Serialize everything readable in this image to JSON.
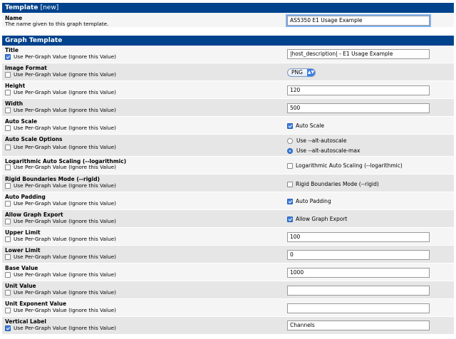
{
  "template_panel": {
    "title": "Template",
    "title_suffix": "[new]",
    "name_label": "Name",
    "name_desc": "The name given to this graph template.",
    "name_value": "AS5350 E1 Usage Example"
  },
  "graph_panel": {
    "title": "Graph Template",
    "per_graph_label": "Use Per-Graph Value (Ignore this Value)",
    "rows": {
      "title": {
        "label": "Title",
        "per_graph": true,
        "value": "|host_description| - E1 Usage Example"
      },
      "image_format": {
        "label": "Image Format",
        "per_graph": false,
        "value": "PNG"
      },
      "height": {
        "label": "Height",
        "per_graph": false,
        "value": "120"
      },
      "width": {
        "label": "Width",
        "per_graph": false,
        "value": "500"
      },
      "auto_scale": {
        "label": "Auto Scale",
        "per_graph": false,
        "option": "Auto Scale",
        "checked": true
      },
      "auto_scale_options": {
        "label": "Auto Scale Options",
        "per_graph": false,
        "opt1": "Use --alt-autoscale",
        "opt2": "Use --alt-autoscale-max",
        "selected": "opt2"
      },
      "log_scaling": {
        "label": "Logarithmic Auto Scaling (--logarithmic)",
        "per_graph": false,
        "option": "Logarithmic Auto Scaling (--logarithmic)",
        "checked": false
      },
      "rigid": {
        "label": "Rigid Boundaries Mode (--rigid)",
        "per_graph": false,
        "option": "Rigid Boundaries Mode (--rigid)",
        "checked": false
      },
      "auto_padding": {
        "label": "Auto Padding",
        "per_graph": false,
        "option": "Auto Padding",
        "checked": true
      },
      "graph_export": {
        "label": "Allow Graph Export",
        "per_graph": false,
        "option": "Allow Graph Export",
        "checked": true
      },
      "upper_limit": {
        "label": "Upper Limit",
        "per_graph": false,
        "value": "100"
      },
      "lower_limit": {
        "label": "Lower Limit",
        "per_graph": false,
        "value": "0"
      },
      "base_value": {
        "label": "Base Value",
        "per_graph": false,
        "value": "1000"
      },
      "unit_value": {
        "label": "Unit Value",
        "per_graph": false,
        "value": ""
      },
      "unit_exponent": {
        "label": "Unit Exponent Value",
        "per_graph": false,
        "value": ""
      },
      "vertical_label": {
        "label": "Vertical Label",
        "per_graph": true,
        "value": "Channels"
      }
    }
  },
  "colors": {
    "header": "#00438c",
    "row_odd": "#f5f5f5",
    "row_even": "#e6e6e6",
    "check": "#3b7de0"
  }
}
